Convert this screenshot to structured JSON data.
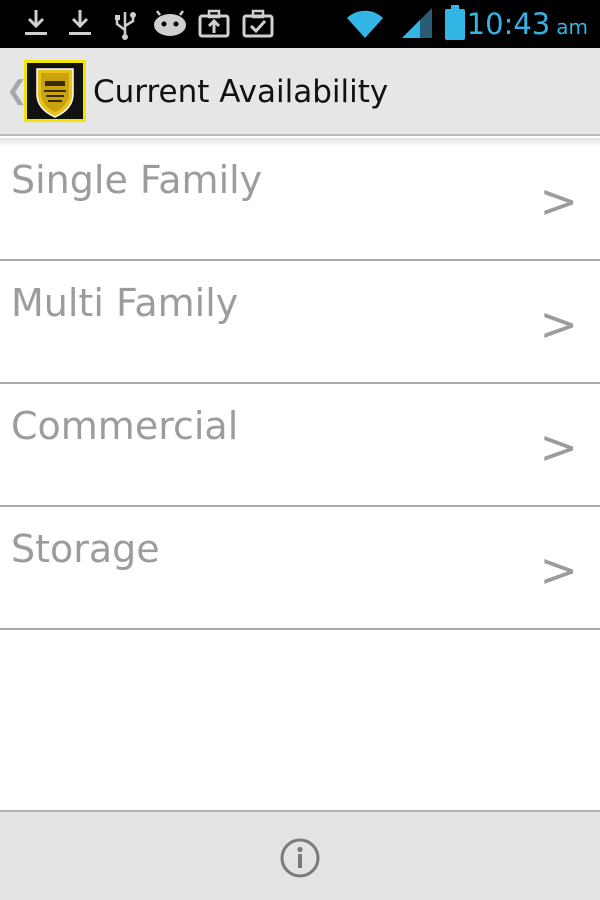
{
  "status_bar": {
    "time": "10:43",
    "ampm": "am",
    "icons": [
      "download-icon",
      "download-icon",
      "usb-icon",
      "android-debug-icon",
      "briefcase-upload-icon",
      "briefcase-check-icon",
      "wifi-icon",
      "cell-signal-icon",
      "battery-icon"
    ],
    "accent_color": "#33b5e5"
  },
  "action_bar": {
    "title": "Current Availability",
    "logo_icon": "gms-badge-logo"
  },
  "list": {
    "items": [
      {
        "label": "Single Family",
        "chevron": ">"
      },
      {
        "label": "Multi Family",
        "chevron": ">"
      },
      {
        "label": "Commercial",
        "chevron": ">"
      },
      {
        "label": "Storage",
        "chevron": ">"
      }
    ]
  },
  "bottom_bar": {
    "info_icon": "info-icon"
  }
}
